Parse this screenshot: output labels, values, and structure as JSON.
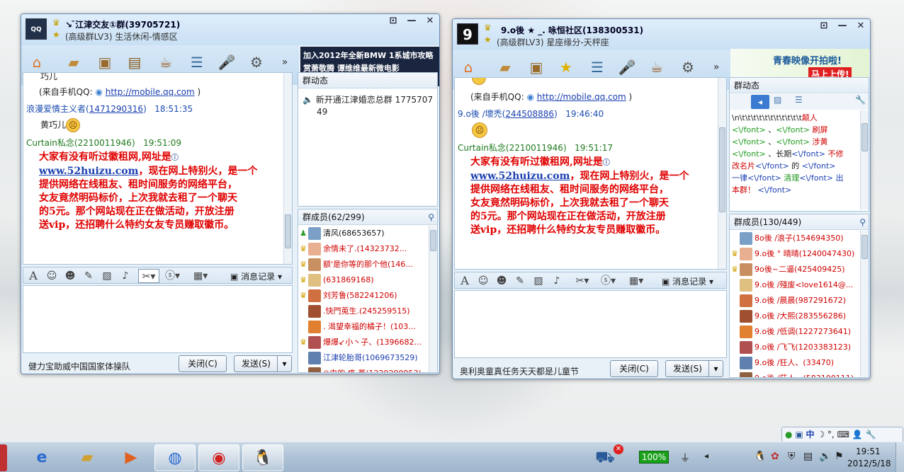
{
  "windows": [
    {
      "group_name": "↘ ̄江津交友①群",
      "group_id": "(39705721)",
      "group_level": "(高级群LV3) 生活休闲-情感区",
      "ad_line1": "加入2012年全新BMW 1系城市攻略",
      "ad_line2": "赏萧敬腾 谭维维最新微电影",
      "messages": {
        "m0": "巧儿",
        "m1_prefix": "(来自手机QQ: ",
        "m1_link": "http://mobile.qq.com",
        "m1_suffix": " )",
        "m2_name": "浪漫爱情主义者",
        "m2_id": "1471290316",
        "m2_time": "18:51:35",
        "m3": "黄巧儿",
        "m4_name": "Curtain私念(2210011946)",
        "m4_time": "19:51:09"
      },
      "spam": {
        "l1": "大家有没有听过徽租网,网址是",
        "l2_url": "www.52huizu.com",
        "l2_rest": "，现在网上特别火，是一个",
        "l3": "提供网络在线租友、租时间服务的网络平台，",
        "l4": "女友竟然明码标价，上次我就去租了一个聊天",
        "l5": "的5元。那个网站现在正在做活动，开放注册",
        "l6": "送vip，还招聘什么特约女友专员赚取徽币。"
      },
      "history_label": "消息记录",
      "status_text": "健力宝助威中国国家体操队",
      "close_label": "关闭(C)",
      "send_label": "发送(S)",
      "dynamics_title": "群动态",
      "dynamics_item": "新开通江津婚恋总群 1775707",
      "dynamics_item2": "49",
      "members_title": "群成员(62/299)",
      "members": [
        {
          "name": "清风(68653657)",
          "color": "#111111",
          "badge": "owner"
        },
        {
          "name": "余情未了.(14323732...",
          "color": "#d00000",
          "badge": "admin"
        },
        {
          "name": "额'是你等的那个他(146...",
          "color": "#d00000",
          "badge": "admin"
        },
        {
          "name": "(631869168)",
          "color": "#d00000",
          "badge": "admin"
        },
        {
          "name": "刘芳鲁(582241206)",
          "color": "#d00000",
          "badge": "admin"
        },
        {
          "name": ".快門莵生.(245259515)",
          "color": "#d00000",
          "badge": ""
        },
        {
          "name": ". 渴望幸福的橘子！(103...",
          "color": "#d00000",
          "badge": ""
        },
        {
          "name": "爆爆↙小丶子、(1396682...",
          "color": "#d00000",
          "badge": "admin"
        },
        {
          "name": "江津轮胎哥(1069673529)",
          "color": "#1a3fb0",
          "badge": ""
        },
        {
          "name": "※虫的 疼 莘(1229290953)",
          "color": "#d00000",
          "badge": ""
        }
      ]
    },
    {
      "group_name": "9.o後 ★ _. 咏恒社区",
      "group_id": "(138300531)",
      "group_level": "(高级群LV3) 星座缘分-天枰座",
      "ad_line1": "青春映像开拍啦!",
      "ad_line2": "马上上传!",
      "messages": {
        "m1_prefix": "(来自手机QQ: ",
        "m1_link": "http://mobile.qq.com",
        "m1_suffix": " )",
        "m2_name": "9.o後 ∕壞禿",
        "m2_id": "244508886",
        "m2_time": "19:46:40",
        "m4_name": "Curtain私念(2210011946)",
        "m4_time": "19:51:17"
      },
      "spam": {
        "l1": "大家有没有听过徽租网,网址是",
        "l2_url": "www.52huizu.com",
        "l2_rest": "，现在网上特别火，是一个",
        "l3": "提供网络在线租友、租时间服务的网络平台，",
        "l4": "女友竟然明码标价，上次我就去租了一个聊天",
        "l5": "的5元。那个网站现在正在做活动，开放注册",
        "l6": "送vip，还招聘什么特约女友专员赚取徽币。"
      },
      "history_label": "消息记录",
      "status_text": "奥利奥童真任务天天都是儿童节",
      "close_label": "关闭(C)",
      "send_label": "发送(S)",
      "dynamics_title": "群动态",
      "dynamics_text": {
        "a": "\\n\\t\\t\\t\\t\\t\\t\\t\\t\\t\\t\\t",
        "a2": "颠人",
        "b1": "<\\/font>",
        "b2": " 、",
        "b3": "<\\/font>",
        "b4": " 刷屏",
        "c1": "<\\/font>",
        "c2": " 、",
        "c3": "<\\/font>",
        "c4": " 涉黄",
        "d1": "<\\/font>",
        "d2": " 、长期",
        "d3": "<\\/font>",
        "d4": " 不修",
        "e1": "改名片",
        "e2": "<\\/font>",
        "e3": " 的 ",
        "e4": "<\\/font>",
        "f1": "一律",
        "f2": "<\\/font>",
        "f3": " 清理",
        "f4": "<\\/font>",
        "f5": " 出",
        "g1": "本群！",
        "g2": " <\\/font>"
      },
      "members_title": "群成员(130/449)",
      "members": [
        {
          "name": "8o後 ∕浪子(154694350)",
          "color": "#d00000",
          "badge": ""
        },
        {
          "name": "9.o後 ° 晴晴(1240047430)",
          "color": "#d00000",
          "badge": "admin"
        },
        {
          "name": "9o後~二逼(425409425)",
          "color": "#d00000",
          "badge": "admin"
        },
        {
          "name": "9.o後 ∕殘废<love1614@...",
          "color": "#d00000",
          "badge": ""
        },
        {
          "name": "9.o後 ∕晨晨(987291672)",
          "color": "#d00000",
          "badge": ""
        },
        {
          "name": "9.o後 ∕大熙(283556286)",
          "color": "#d00000",
          "badge": ""
        },
        {
          "name": "9.o後 ∕低调(1227273641)",
          "color": "#d00000",
          "badge": ""
        },
        {
          "name": "9.o後 ∕飞飞(1203383123)",
          "color": "#d00000",
          "badge": ""
        },
        {
          "name": "9.o後 ∕狂人、(33470)",
          "color": "#d00000",
          "badge": ""
        },
        {
          "name": "9.o後 ∕莊人、(583100111)",
          "color": "#d00000",
          "badge": ""
        }
      ]
    }
  ],
  "taskbar": {
    "battery": "100%",
    "time": "19:51",
    "date": "2012/5/18"
  },
  "ime": {
    "mode": "中"
  },
  "colors": {
    "spam_red": "#e00000",
    "link_blue": "#1a3fb0",
    "name_green": "#1e7a1e"
  }
}
